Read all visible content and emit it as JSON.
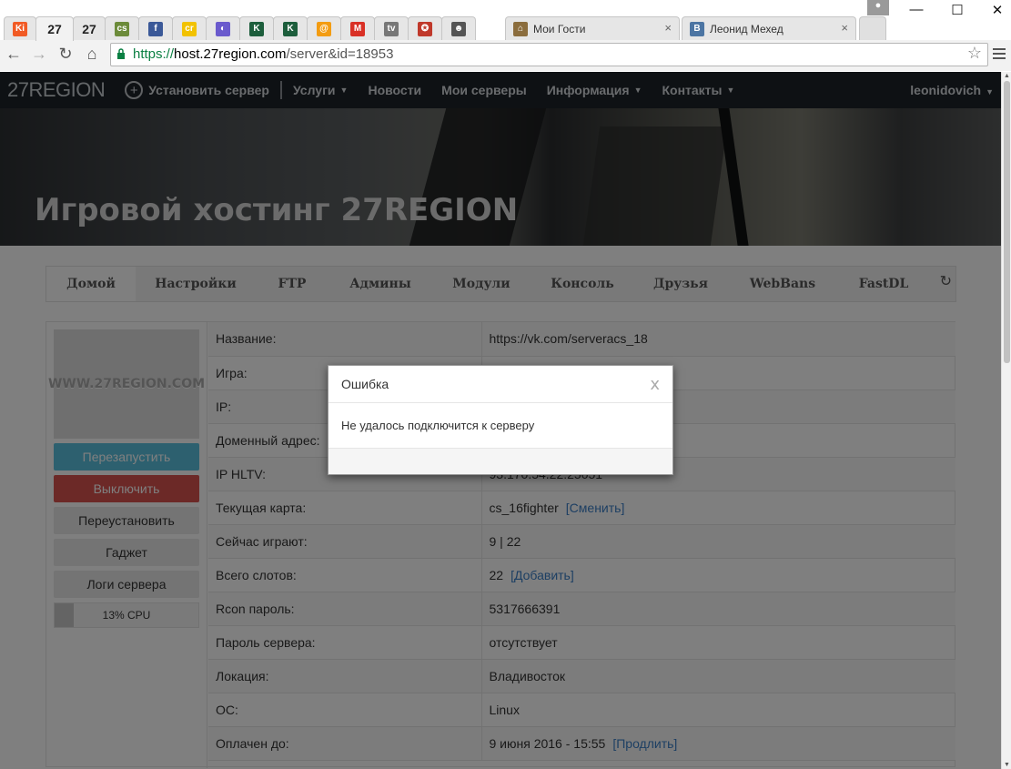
{
  "browser": {
    "tabs": [
      {
        "icon": "Ki",
        "color": "#f15a24"
      },
      {
        "icon": "27",
        "color": "#ffffff",
        "active": true
      },
      {
        "icon": "27",
        "color": "#ffffff"
      },
      {
        "icon": "cs",
        "color": "#6c8b3a"
      },
      {
        "icon": "f",
        "color": "#3b5998"
      },
      {
        "icon": "cr",
        "color": "#f2c200"
      },
      {
        "icon": "◐",
        "color": "#6a5acd"
      },
      {
        "icon": "K",
        "color": "#1d5e3c"
      },
      {
        "icon": "K",
        "color": "#1d5e3c"
      },
      {
        "icon": "@",
        "color": "#f39c12"
      },
      {
        "icon": "M",
        "color": "#d93025"
      },
      {
        "icon": "tv",
        "color": "#777777"
      },
      {
        "icon": "✪",
        "color": "#c0392b"
      },
      {
        "icon": "☻",
        "color": "#555555"
      }
    ],
    "wide_tabs": [
      {
        "title": "Мои Гости",
        "close": "×"
      },
      {
        "title": "Леонид Мехед",
        "close": "×"
      }
    ],
    "window_controls": {
      "minimize": "—",
      "maximize": "☐",
      "close": "✕"
    },
    "url_scheme": "https://",
    "url_host": "host.27region.com",
    "url_path": "/server&id=18953"
  },
  "nav": {
    "brand": "27REGION",
    "install": "Установить сервер",
    "services": "Услуги",
    "news": "Новости",
    "my_servers": "Мои серверы",
    "info": "Информация",
    "contacts": "Контакты",
    "user": "leonidovich"
  },
  "hero": {
    "title": "Игровой хостинг 27REGION"
  },
  "server_tabs": [
    "Домой",
    "Настройки",
    "FTP",
    "Админы",
    "Модули",
    "Консоль",
    "Друзья",
    "WebBans",
    "FastDL"
  ],
  "sidebar": {
    "logo_text": "WWW.27REGION.COM",
    "restart": "Перезапустить",
    "off": "Выключить",
    "reinstall": "Переустановить",
    "gadget": "Гаджет",
    "logs": "Логи сервера",
    "cpu_label": "13% CPU",
    "cpu_value": 13
  },
  "info_rows": [
    {
      "label": "Название:",
      "value": "https://vk.com/serveracs_18",
      "link": ""
    },
    {
      "label": "Игра:",
      "value": "",
      "link": ""
    },
    {
      "label": "IP:",
      "value": "",
      "link": ""
    },
    {
      "label": "Доменный адрес:",
      "value": "",
      "link": ""
    },
    {
      "label": "IP HLTV:",
      "value": "93.170.54.22:25051",
      "link": ""
    },
    {
      "label": "Текущая карта:",
      "value": "cs_16fighter",
      "link": "[Сменить]"
    },
    {
      "label": "Сейчас играют:",
      "value": "9 | 22",
      "link": ""
    },
    {
      "label": "Всего слотов:",
      "value": "22",
      "link": "[Добавить]"
    },
    {
      "label": "Rcon пароль:",
      "value": "5317666391",
      "link": ""
    },
    {
      "label": "Пароль сервера:",
      "value": "отсутствует",
      "link": ""
    },
    {
      "label": "Локация:",
      "value": "Владивосток",
      "link": ""
    },
    {
      "label": "ОС:",
      "value": "Linux",
      "link": ""
    },
    {
      "label": "Оплачен до:",
      "value": "9 июня 2016 - 15:55",
      "link": "[Продлить]"
    }
  ],
  "modal": {
    "title": "Ошибка",
    "close": "x",
    "message": "Не удалось подключится к серверу"
  }
}
